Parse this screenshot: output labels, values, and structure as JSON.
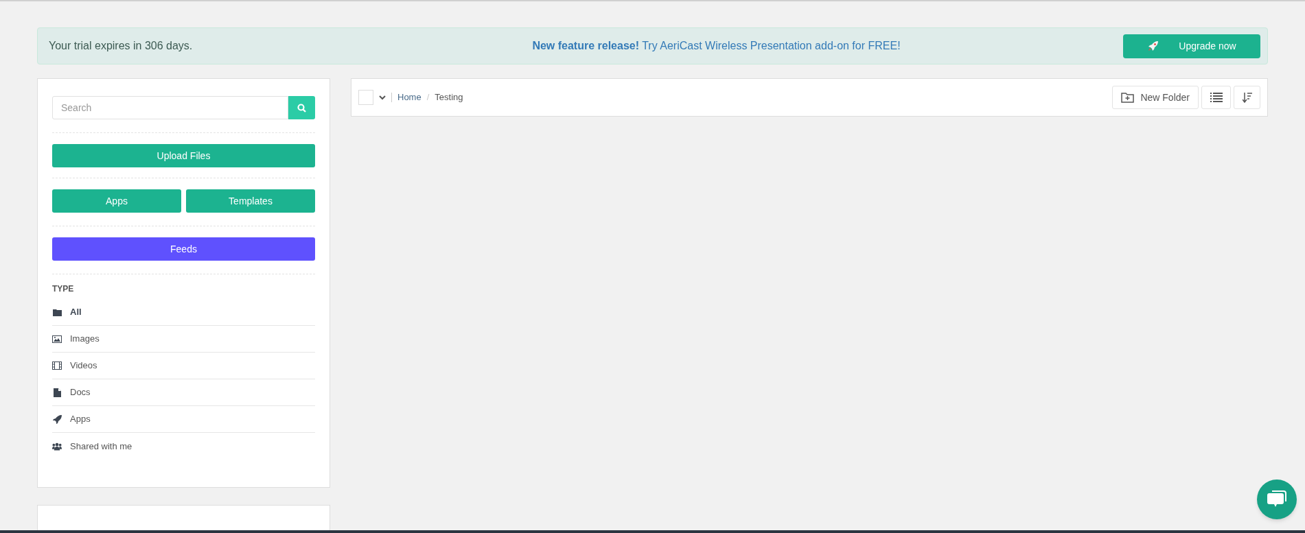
{
  "banner": {
    "trial": "Your trial expires in 306 days.",
    "announcement": "**New feature release!** Try AeriCast Wireless Presentation add-on for FREE!",
    "button": "Upgrade now"
  },
  "sidebar": {
    "search": {
      "placeholder": "Search"
    },
    "upload_button": "Upload Files",
    "apps_button": "Apps",
    "templates_button": "Templates",
    "feeds_button": "Feeds",
    "type_heading": "TYPE",
    "type_items": [
      {
        "label": "All",
        "selected": true
      },
      {
        "label": "Images",
        "selected": false
      },
      {
        "label": "Videos",
        "selected": false
      },
      {
        "label": "Docs",
        "selected": false
      },
      {
        "label": "Apps",
        "selected": false
      },
      {
        "label": "Shared with me",
        "selected": false
      }
    ]
  },
  "toolbar": {
    "select_all": {
      "checked": false
    },
    "breadcrumb_separator": "/",
    "breadcrumb": [
      {
        "label": "Home"
      },
      {
        "label": "Testing"
      }
    ],
    "new_folder_button": "New Folder"
  }
}
